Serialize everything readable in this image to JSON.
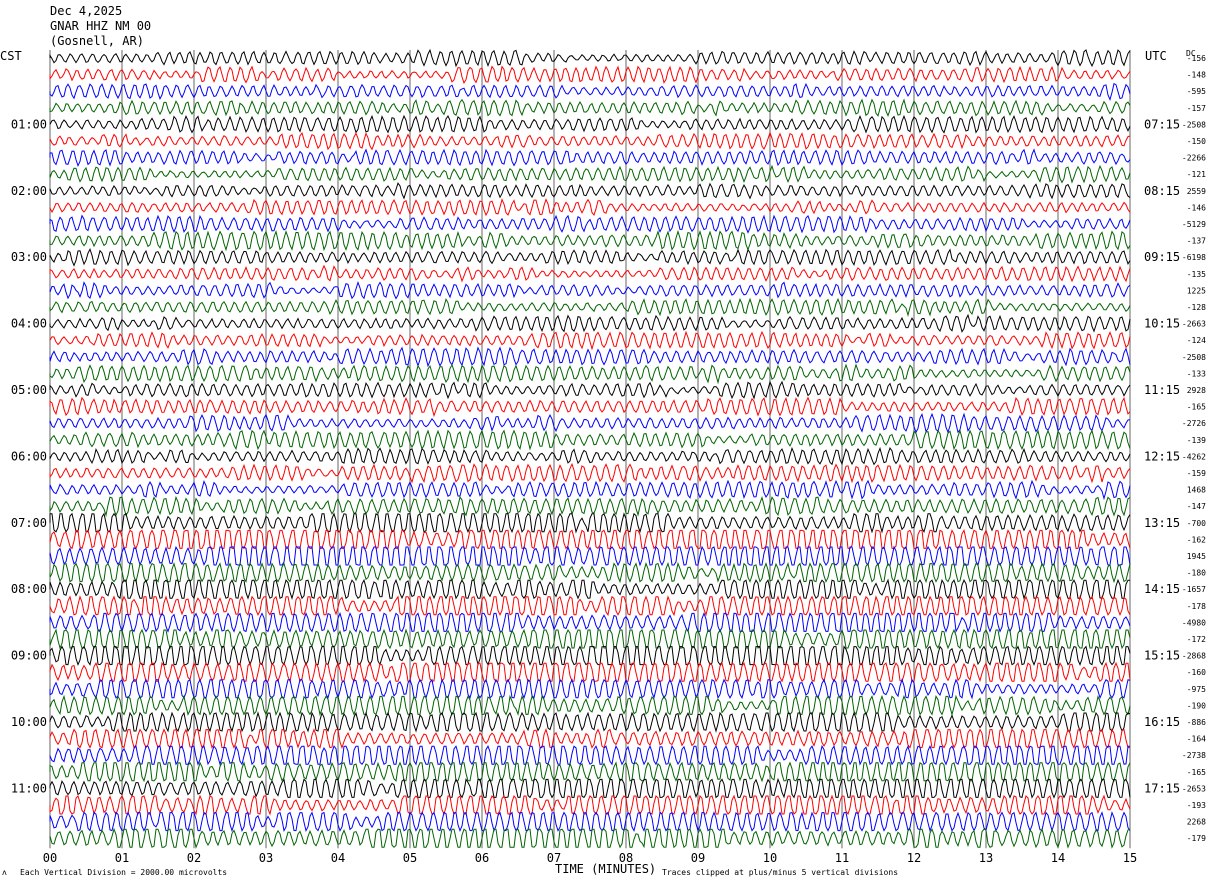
{
  "header": {
    "date": "Dec 4,2025",
    "station": "GNAR HHZ NM 00",
    "location": "(Gosnell, AR)"
  },
  "axis_titles": {
    "left": "CST",
    "right": "UTC",
    "right_top": "DC"
  },
  "footer": {
    "scale_note": "Each Vertical Division = 2000.00 microvolts",
    "xlabel": "TIME (MINUTES)",
    "clip_note": "Traces clipped at plus/minus 5 vertical divisions"
  },
  "colors": {
    "cycle": [
      "#000000",
      "#ff0000",
      "#0000ff",
      "#006400"
    ]
  },
  "chart_data": {
    "type": "line",
    "title": "GNAR HHZ NM 00",
    "xlabel": "TIME (MINUTES)",
    "xlim": [
      0,
      15
    ],
    "x_ticks": [
      "00",
      "01",
      "02",
      "03",
      "04",
      "05",
      "06",
      "07",
      "08",
      "09",
      "10",
      "11",
      "12",
      "13",
      "14",
      "15"
    ],
    "trace_minutes": 15,
    "trace_count": 48,
    "grid": "vertical-minute-lines",
    "left_time_labels": [
      {
        "row": 4,
        "label": "01:00"
      },
      {
        "row": 8,
        "label": "02:00"
      },
      {
        "row": 12,
        "label": "03:00"
      },
      {
        "row": 16,
        "label": "04:00"
      },
      {
        "row": 20,
        "label": "05:00"
      },
      {
        "row": 24,
        "label": "06:00"
      },
      {
        "row": 28,
        "label": "07:00"
      },
      {
        "row": 32,
        "label": "08:00"
      },
      {
        "row": 36,
        "label": "09:00"
      },
      {
        "row": 40,
        "label": "10:00"
      },
      {
        "row": 44,
        "label": "11:00"
      }
    ],
    "right_time_labels": [
      {
        "row": 4,
        "label": "07:15"
      },
      {
        "row": 8,
        "label": "08:15"
      },
      {
        "row": 12,
        "label": "09:15"
      },
      {
        "row": 16,
        "label": "10:15"
      },
      {
        "row": 20,
        "label": "11:15"
      },
      {
        "row": 24,
        "label": "12:15"
      },
      {
        "row": 28,
        "label": "13:15"
      },
      {
        "row": 32,
        "label": "14:15"
      },
      {
        "row": 36,
        "label": "15:15"
      },
      {
        "row": 40,
        "label": "16:15"
      },
      {
        "row": 44,
        "label": "17:15"
      }
    ],
    "dc_offsets": [
      "-156",
      "-148",
      "-595",
      "-157",
      "-2508",
      "-150",
      "-2266",
      "-121",
      "2559",
      "-146",
      "-5129",
      "-137",
      "-6198",
      "-135",
      "1225",
      "-128",
      "-2663",
      "-124",
      "-2508",
      "-133",
      "2928",
      "-165",
      "-2726",
      "-139",
      "-4262",
      "-159",
      "1468",
      "-147",
      "-700",
      "-162",
      "1945",
      "-180",
      "-1657",
      "-178",
      "-4980",
      "-172",
      "-2868",
      "-160",
      "-975",
      "-190",
      "-886",
      "-164",
      "-2738",
      "-165",
      "-2653",
      "-193",
      "2268",
      "-179"
    ],
    "trace_activity": [
      1,
      1,
      1,
      1,
      1,
      1,
      1,
      1,
      1,
      1,
      1,
      1.1,
      1,
      1,
      1,
      1,
      1,
      1,
      1.1,
      1.1,
      1,
      1.1,
      1.1,
      1.1,
      1,
      1.1,
      1.1,
      1.2,
      1.5,
      1.8,
      2,
      1.3,
      1.6,
      1.7,
      1.6,
      1.6,
      1.8,
      1.7,
      1.4,
      1.4,
      1.5,
      1.4,
      1.6,
      1.6,
      1.6,
      1.6,
      1.6,
      1.7
    ]
  }
}
